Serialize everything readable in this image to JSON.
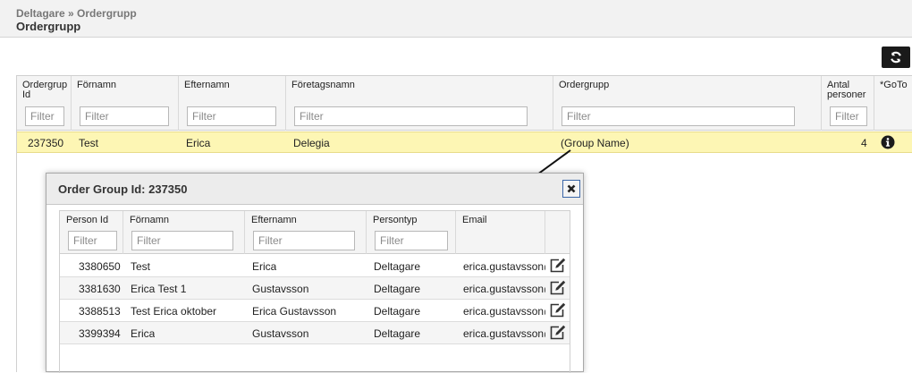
{
  "header": {
    "breadcrumb": "Deltagare » Ordergrupp",
    "title": "Ordergrupp"
  },
  "toolbar": {
    "refresh_icon": "refresh-icon"
  },
  "main_grid": {
    "columns": [
      {
        "label_1": "Ordergrup",
        "label_2": "Id",
        "filter_placeholder": "Filter"
      },
      {
        "label_1": "Förnamn",
        "label_2": "",
        "filter_placeholder": "Filter"
      },
      {
        "label_1": "Efternamn",
        "label_2": "",
        "filter_placeholder": "Filter"
      },
      {
        "label_1": "Företagsnamn",
        "label_2": "",
        "filter_placeholder": "Filter"
      },
      {
        "label_1": "Ordergrupp",
        "label_2": "",
        "filter_placeholder": "Filter"
      },
      {
        "label_1": "Antal",
        "label_2": "personer",
        "filter_placeholder": "Filter"
      },
      {
        "label_1": "*GoTo",
        "label_2": ""
      }
    ],
    "row": {
      "id": "237350",
      "firstname": "Test",
      "lastname": "Erica",
      "company": "Delegia",
      "ordergroup": "(Group Name)",
      "count": "4",
      "goto_icon": "info-icon"
    },
    "highlight_color": "#fdf6b4"
  },
  "modal": {
    "title": "Order Group Id: 237350",
    "close_icon": "close-icon",
    "columns": [
      {
        "label": "Person Id",
        "filter_placeholder": "Filter"
      },
      {
        "label": "Förnamn",
        "filter_placeholder": "Filter"
      },
      {
        "label": "Efternamn",
        "filter_placeholder": "Filter"
      },
      {
        "label": "Persontyp",
        "filter_placeholder": "Filter"
      },
      {
        "label": "Email"
      }
    ],
    "rows": [
      {
        "person_id": "3380650",
        "firstname": "Test",
        "lastname": "Erica",
        "type": "Deltagare",
        "email": "erica.gustavsson@"
      },
      {
        "person_id": "3381630",
        "firstname": "Erica Test 1",
        "lastname": "Gustavsson",
        "type": "Deltagare",
        "email": "erica.gustavsson@"
      },
      {
        "person_id": "3388513",
        "firstname": "Test Erica oktober",
        "lastname": "Erica Gustavsson",
        "type": "Deltagare",
        "email": "erica.gustavsson@"
      },
      {
        "person_id": "3399394",
        "firstname": "Erica",
        "lastname": "Gustavsson",
        "type": "Deltagare",
        "email": "erica.gustavsson@"
      }
    ],
    "row_edit_icon": "edit-icon"
  }
}
